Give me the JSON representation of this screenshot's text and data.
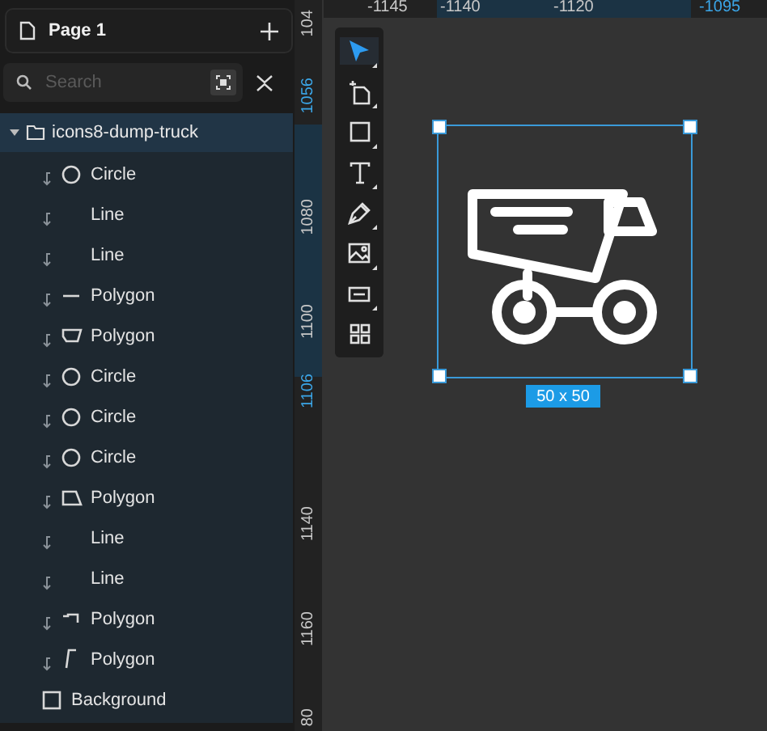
{
  "page": {
    "title": "Page 1"
  },
  "search": {
    "placeholder": "Search"
  },
  "layers": {
    "group": {
      "name": "icons8-dump-truck",
      "expanded": true,
      "children": [
        {
          "name": "Circle",
          "kind": "circle"
        },
        {
          "name": "Line",
          "kind": "line"
        },
        {
          "name": "Line",
          "kind": "line"
        },
        {
          "name": "Polygon",
          "kind": "bar"
        },
        {
          "name": "Polygon",
          "kind": "tray"
        },
        {
          "name": "Circle",
          "kind": "circle"
        },
        {
          "name": "Circle",
          "kind": "circle"
        },
        {
          "name": "Circle",
          "kind": "circle"
        },
        {
          "name": "Polygon",
          "kind": "trapezoid"
        },
        {
          "name": "Line",
          "kind": "line"
        },
        {
          "name": "Line",
          "kind": "line"
        },
        {
          "name": "Polygon",
          "kind": "hook"
        },
        {
          "name": "Polygon",
          "kind": "corner"
        }
      ]
    },
    "background": {
      "name": "Background"
    }
  },
  "ruler_top": [
    {
      "label": "-1145",
      "selected": false
    },
    {
      "label": "-1140",
      "selected": false
    },
    {
      "label": "-1120",
      "selected": false
    },
    {
      "label": "-1095",
      "selected": true
    }
  ],
  "ruler_left": [
    {
      "label": "104",
      "selected": false
    },
    {
      "label": "1056",
      "selected": true
    },
    {
      "label": "1080",
      "selected": false
    },
    {
      "label": "1100",
      "selected": false
    },
    {
      "label": "1106",
      "selected": true
    },
    {
      "label": "1140",
      "selected": false
    },
    {
      "label": "1160",
      "selected": false
    },
    {
      "label": "80",
      "selected": false
    }
  ],
  "tools": [
    {
      "kind": "select",
      "selected": true
    },
    {
      "kind": "page",
      "selected": false
    },
    {
      "kind": "rect",
      "selected": false
    },
    {
      "kind": "text",
      "selected": false
    },
    {
      "kind": "pen",
      "selected": false
    },
    {
      "kind": "image",
      "selected": false
    },
    {
      "kind": "input",
      "selected": false
    },
    {
      "kind": "grid",
      "selected": false
    }
  ],
  "selection": {
    "size": "50 x 50"
  }
}
